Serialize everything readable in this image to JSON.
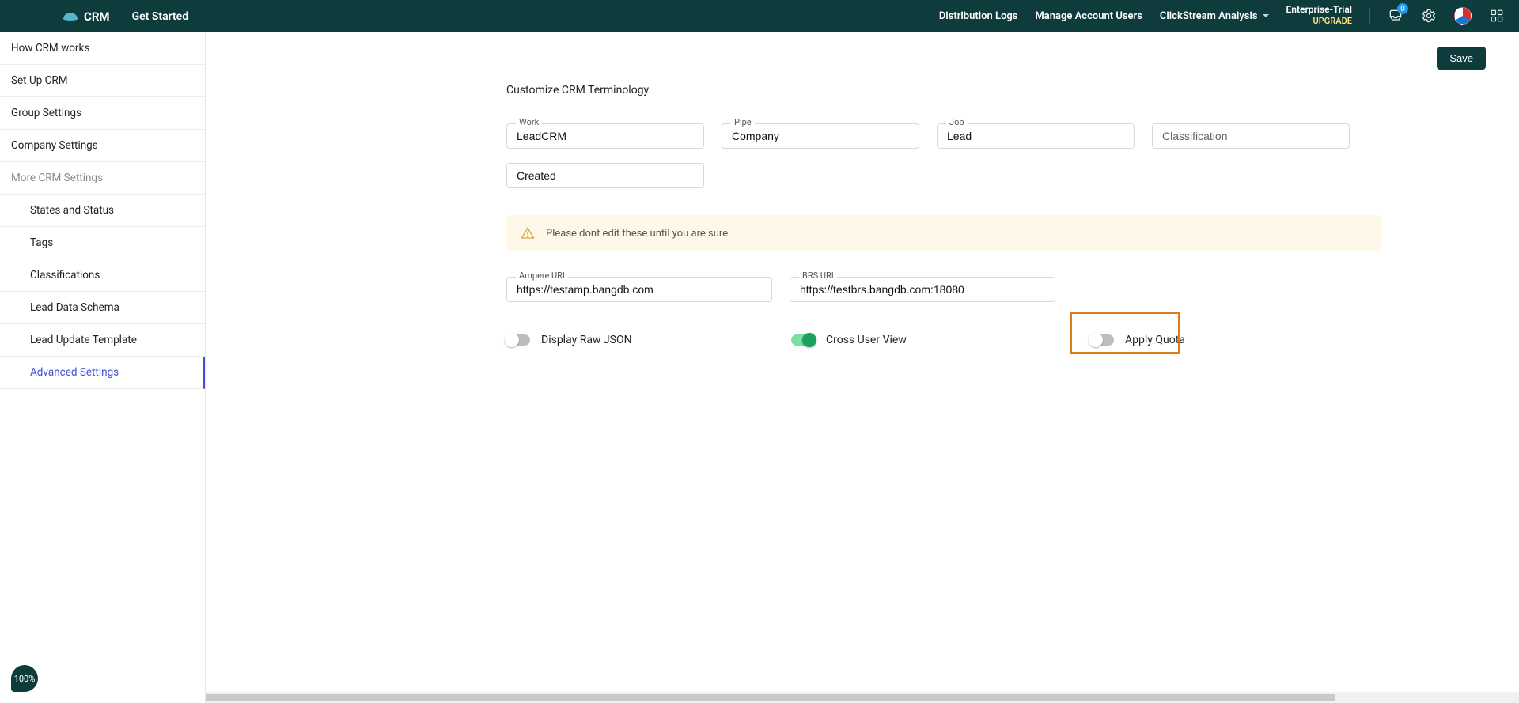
{
  "header": {
    "brand": "CRM",
    "getStarted": "Get Started",
    "nav": {
      "distribution": "Distribution Logs",
      "manageUsers": "Manage Account Users",
      "clickstream": "ClickStream Analysis"
    },
    "trial": {
      "line1": "Enterprise-Trial",
      "upgrade": "UPGRADE"
    },
    "badgeCount": "0"
  },
  "sidebar": {
    "items": [
      {
        "label": "How CRM works"
      },
      {
        "label": "Set Up CRM"
      },
      {
        "label": "Group Settings"
      },
      {
        "label": "Company Settings"
      }
    ],
    "moreHeader": "More CRM Settings",
    "subs": [
      {
        "label": "States and Status"
      },
      {
        "label": "Tags"
      },
      {
        "label": "Classifications"
      },
      {
        "label": "Lead Data Schema"
      },
      {
        "label": "Lead Update Template"
      },
      {
        "label": "Advanced Settings"
      }
    ]
  },
  "content": {
    "saveLabel": "Save",
    "title": "Customize CRM Terminology.",
    "fields": {
      "work": {
        "label": "Work",
        "value": "LeadCRM"
      },
      "pipe": {
        "label": "Pipe",
        "value": "Company"
      },
      "job": {
        "label": "Job",
        "value": "Lead"
      },
      "classification": {
        "placeholder": "Classification"
      },
      "created": {
        "value": "Created"
      }
    },
    "warning": "Please dont edit these until you are sure.",
    "ampere": {
      "label": "Ampere URI",
      "value": "https://testamp.bangdb.com"
    },
    "brs": {
      "label": "BRS URI",
      "value": "https://testbrs.bangdb.com:18080"
    },
    "toggles": {
      "rawjson": "Display Raw JSON",
      "crossuser": "Cross User View",
      "applyquota": "Apply Quota"
    }
  },
  "zoom": "100%"
}
